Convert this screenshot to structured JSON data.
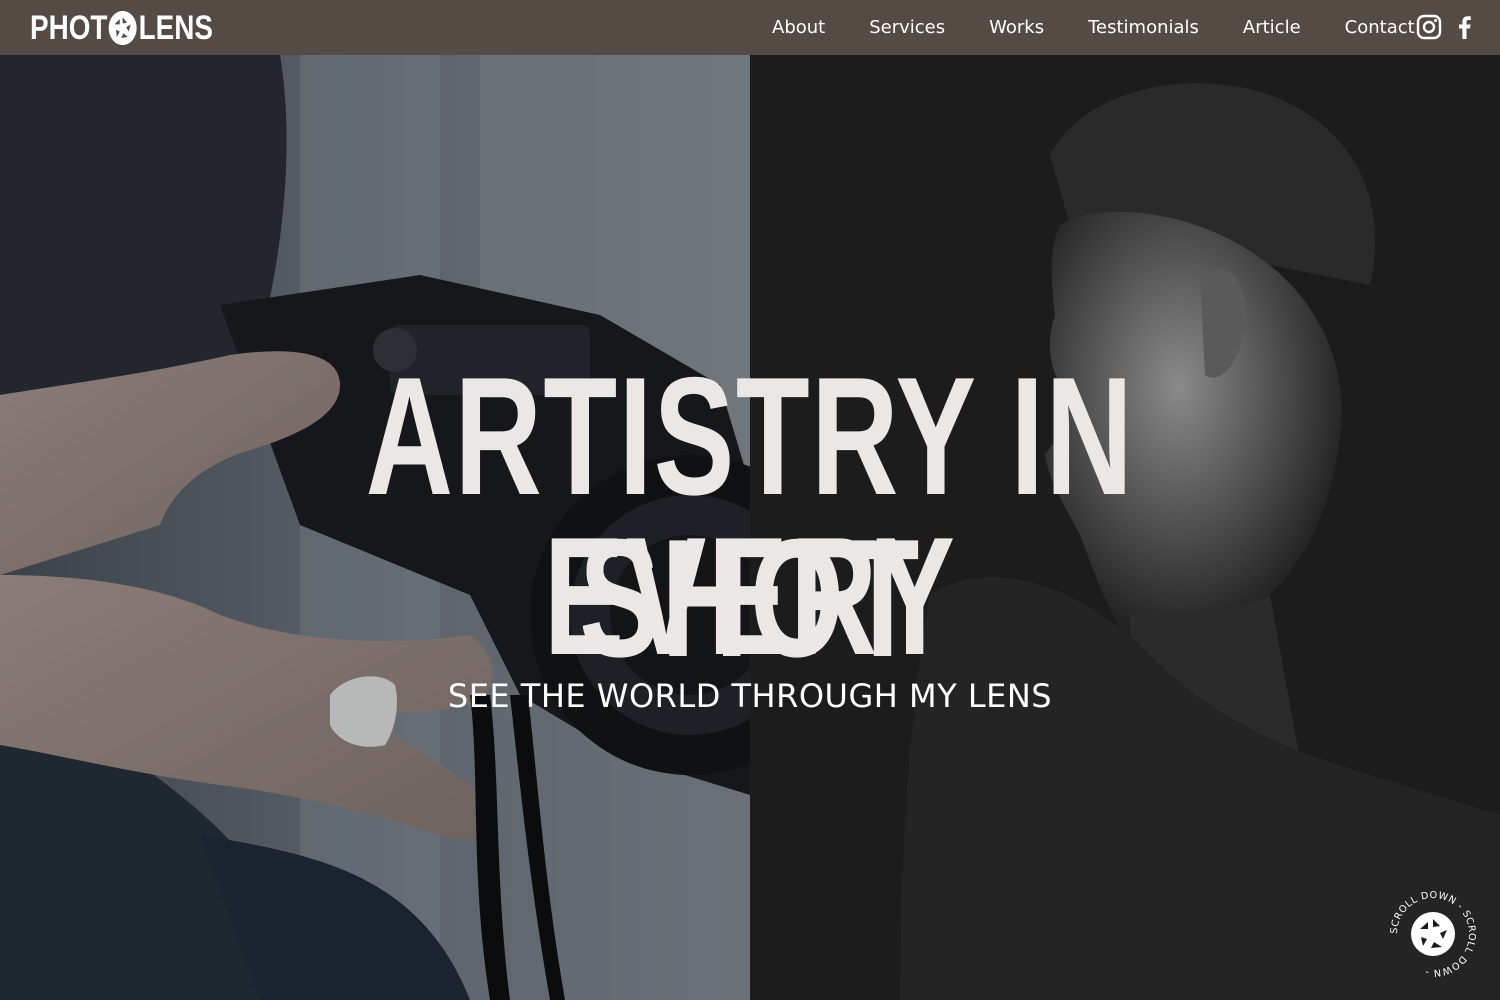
{
  "header": {
    "logo": {
      "part1": "PHOT",
      "part2": "LENS",
      "icon": "aperture-icon"
    },
    "nav": [
      {
        "label": "About"
      },
      {
        "label": "Services"
      },
      {
        "label": "Works"
      },
      {
        "label": "Testimonials"
      },
      {
        "label": "Article"
      },
      {
        "label": "Contact"
      }
    ],
    "social": [
      {
        "icon": "instagram-icon"
      },
      {
        "icon": "facebook-icon"
      }
    ]
  },
  "hero": {
    "headline_line1": "ARTISTRY IN EVERY",
    "headline_line2": "SHOT",
    "tagline": "SEE THE WORLD THROUGH MY LENS",
    "scroll_badge": {
      "text": "SCROLL DOWN - SCROLL DOWN - ",
      "icon": "aperture-icon"
    }
  },
  "colors": {
    "header_bg": "#554b45",
    "text": "#ffffff",
    "headline": "#ebe7e5",
    "dark_panel": "#1c1c1c"
  }
}
